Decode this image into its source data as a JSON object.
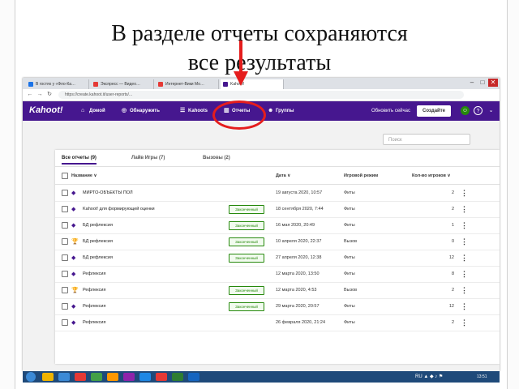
{
  "slide": {
    "title_line1": "В разделе отчеты сохраняются",
    "title_line2": "все результаты",
    "accent_color": "#e51d1d"
  },
  "browser": {
    "tabs": [
      {
        "label": "В гостях у «Фло-Ка…",
        "favicon_color": "#1a73e8"
      },
      {
        "label": "Экспресс — Видео…",
        "favicon_color": "#e53935"
      },
      {
        "label": "Интернет-Вики Мо…",
        "favicon_color": "#e53935"
      },
      {
        "label": "Kahoot!",
        "favicon_color": "#46178f"
      }
    ],
    "url": "https://create.kahoot.it/user-reports/...",
    "window_controls": [
      "–",
      "□",
      "✕"
    ]
  },
  "kahoot": {
    "brand_color": "#46178f",
    "logo": "Kahoot!",
    "nav": [
      {
        "label": "Домой",
        "icon": "home-icon",
        "glyph": "⌂"
      },
      {
        "label": "Обнаружить",
        "icon": "compass-icon",
        "glyph": "◎"
      },
      {
        "label": "Kahoots",
        "icon": "list-icon",
        "glyph": "☰"
      },
      {
        "label": "Отчеты",
        "icon": "chart-icon",
        "glyph": "▥"
      },
      {
        "label": "Группы",
        "icon": "group-icon",
        "glyph": "☻"
      }
    ],
    "play_label": "Обновить сейчас",
    "create_label": "Создайте",
    "help_glyph": "?",
    "search_placeholder": "Поиск"
  },
  "reports": {
    "tabs": [
      {
        "label": "Все отчеты (9)",
        "active": true
      },
      {
        "label": "Лайв Игры (7)",
        "active": false
      },
      {
        "label": "Вызовы (2)",
        "active": false
      }
    ],
    "columns": {
      "name": "Название ∨",
      "date": "Дата ∨",
      "mode": "Игровой режим",
      "players": "Кол-во игроков ∨"
    },
    "finished_label": "Законченный",
    "rows": [
      {
        "name": "МИРТО-ОБЪЕКТЫ ПОЛ",
        "badge": false,
        "icon": "kahoot-icon",
        "date": "19 августа 2020, 10:57",
        "mode": "Фиты",
        "players": "2"
      },
      {
        "name": "Kahoot! для формирующей оценки",
        "badge": true,
        "icon": "kahoot-icon",
        "date": "18 сентября 2020, 7:44",
        "mode": "Фиты",
        "players": "2"
      },
      {
        "name": "БД рефлексия",
        "badge": true,
        "icon": "kahoot-icon",
        "date": "16 мая 2020, 20:49",
        "mode": "Фиты",
        "players": "1"
      },
      {
        "name": "БД рефлексия",
        "badge": true,
        "icon": "trophy-icon",
        "date": "10 апреля 2020, 22:37",
        "mode": "Вызов",
        "players": "0"
      },
      {
        "name": "БД рефлексия",
        "badge": true,
        "icon": "kahoot-icon",
        "date": "27 апреля 2020, 12:38",
        "mode": "Фиты",
        "players": "12"
      },
      {
        "name": "Рефлексия",
        "badge": false,
        "icon": "kahoot-icon",
        "date": "12 марта 2020, 13:50",
        "mode": "Фиты",
        "players": "8"
      },
      {
        "name": "Рефлексия",
        "badge": true,
        "icon": "trophy-icon",
        "date": "12 марта 2020, 4:53",
        "mode": "Вызов",
        "players": "2"
      },
      {
        "name": "Рефлексия",
        "badge": true,
        "icon": "kahoot-icon",
        "date": "29 марта 2020, 20:57",
        "mode": "Фиты",
        "players": "12"
      },
      {
        "name": "Рефлексия",
        "badge": false,
        "icon": "kahoot-icon",
        "date": "26 февраля 2020, 21:24",
        "mode": "Фиты",
        "players": "2"
      }
    ]
  },
  "taskbar": {
    "apps": [
      "#f0b400",
      "#3c8ad6",
      "#e53935",
      "#43a047",
      "#ff9800",
      "#8e24aa",
      "#1e88e5",
      "#e53935",
      "#2e7d32",
      "#1565c0"
    ],
    "tray": "RU ▲ ◆ ♪ ⚑",
    "clock": "13:51"
  }
}
